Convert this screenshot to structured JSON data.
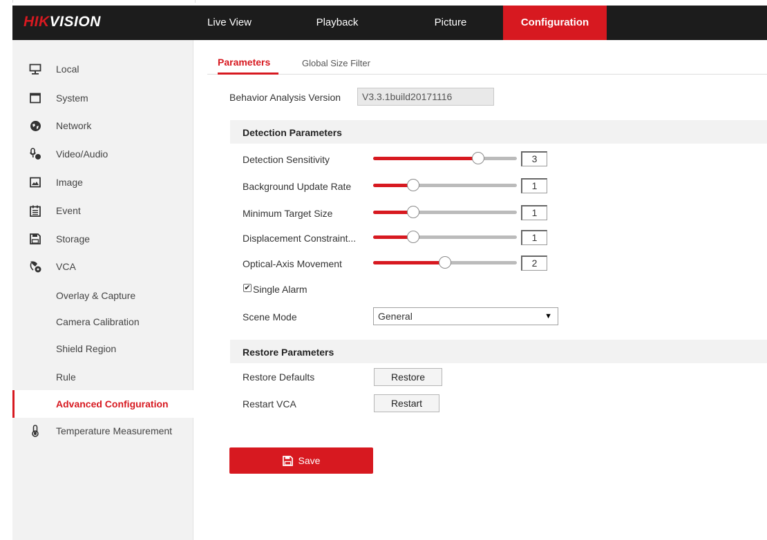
{
  "brand": {
    "logo_part1": "HIK",
    "logo_part2": "VISION"
  },
  "nav": [
    "Live View",
    "Playback",
    "Picture",
    "Configuration"
  ],
  "nav_active": "Configuration",
  "sidebar": {
    "items": [
      {
        "label": "Local",
        "icon": "monitor-icon"
      },
      {
        "label": "System",
        "icon": "window-icon"
      },
      {
        "label": "Network",
        "icon": "globe-icon"
      },
      {
        "label": "Video/Audio",
        "icon": "microphone-icon"
      },
      {
        "label": "Image",
        "icon": "image-icon"
      },
      {
        "label": "Event",
        "icon": "calendar-icon"
      },
      {
        "label": "Storage",
        "icon": "floppy-icon"
      },
      {
        "label": "VCA",
        "icon": "vca-icon"
      }
    ],
    "vca_subitems": [
      "Overlay & Capture",
      "Camera Calibration",
      "Shield Region",
      "Rule",
      "Advanced Configuration"
    ],
    "active_subitem": "Advanced Configuration",
    "last_item": {
      "label": "Temperature Measurement",
      "icon": "thermometer-icon"
    }
  },
  "tabs": [
    "Parameters",
    "Global Size Filter"
  ],
  "active_tab": "Parameters",
  "version": {
    "label": "Behavior Analysis Version",
    "value": "V3.3.1build20171116"
  },
  "detection": {
    "title": "Detection Parameters",
    "sliders": [
      {
        "label": "Detection Sensitivity",
        "value": "3",
        "fraction": 0.73
      },
      {
        "label": "Background Update Rate",
        "value": "1",
        "fraction": 0.28
      },
      {
        "label": "Minimum Target Size",
        "value": "1",
        "fraction": 0.28
      },
      {
        "label": "Displacement Constraint...",
        "value": "1",
        "fraction": 0.28
      },
      {
        "label": "Optical-Axis Movement",
        "value": "2",
        "fraction": 0.5
      }
    ],
    "single_alarm": {
      "label": "Single Alarm",
      "checked": true
    },
    "scene_mode": {
      "label": "Scene Mode",
      "value": "General"
    }
  },
  "restore": {
    "title": "Restore Parameters",
    "defaults_label": "Restore Defaults",
    "restore_button": "Restore",
    "restart_label": "Restart VCA",
    "restart_button": "Restart"
  },
  "save_label": "Save",
  "colors": {
    "accent": "#d71920",
    "header_bg": "#1c1c1c",
    "sidebar_bg": "#f2f2f2"
  }
}
